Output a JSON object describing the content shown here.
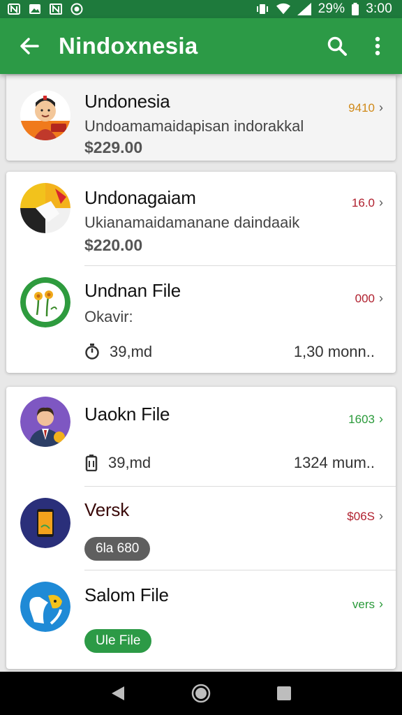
{
  "status_bar": {
    "time": "3:00",
    "battery": "29%",
    "left_icons": [
      "n-notification-icon",
      "image-notification-icon",
      "n-box-notification-icon",
      "sync-notification-icon"
    ],
    "right_icons": [
      "vibrate-icon",
      "wifi-icon",
      "signal-icon",
      "battery-icon"
    ]
  },
  "app_bar": {
    "title": "Nindoxnesia",
    "color": "#2c9a46"
  },
  "cards": [
    {
      "rows": [
        {
          "title": "Undonesia",
          "subtitle": "Undoamamaidapisan indorakkal",
          "price": "$229.00",
          "trailing": "9410",
          "trailing_color": "#d08a1a",
          "avatar": "person-flag-avatar"
        }
      ]
    },
    {
      "rows": [
        {
          "title": "Undonagaiam",
          "subtitle": "Ukianamaidamanane daindaaik",
          "price": "$220.00",
          "trailing": "16.0",
          "trailing_color": "#b0202e",
          "avatar": "pie-chart-avatar"
        },
        {
          "title": "Undnan File",
          "subtitle": "Okavir:",
          "meta_icon": "timer-icon",
          "meta_left": "39,md",
          "meta_right": "1,30 monn..",
          "trailing": "000",
          "trailing_color": "#b0202e",
          "avatar": "flower-avatar"
        }
      ]
    },
    {
      "rows": [
        {
          "title": "Uaokn File",
          "meta_icon": "battery-meta-icon",
          "meta_left": "39,md",
          "meta_right": "1324 mum..",
          "trailing": "1603",
          "trailing_color": "#2a9a3a",
          "avatar": "businessman-avatar"
        },
        {
          "title": "Versk",
          "chip": "6la 680",
          "chip_color": "#5f5f5f",
          "trailing": "$06S",
          "trailing_color": "#b0202e",
          "avatar": "phone-avatar"
        },
        {
          "title": "Salom File",
          "chip": "Ule File",
          "chip_color": "#2c9a46",
          "trailing": "vers",
          "trailing_color": "#2a9a3a",
          "avatar": "mascot-avatar"
        }
      ]
    }
  ]
}
